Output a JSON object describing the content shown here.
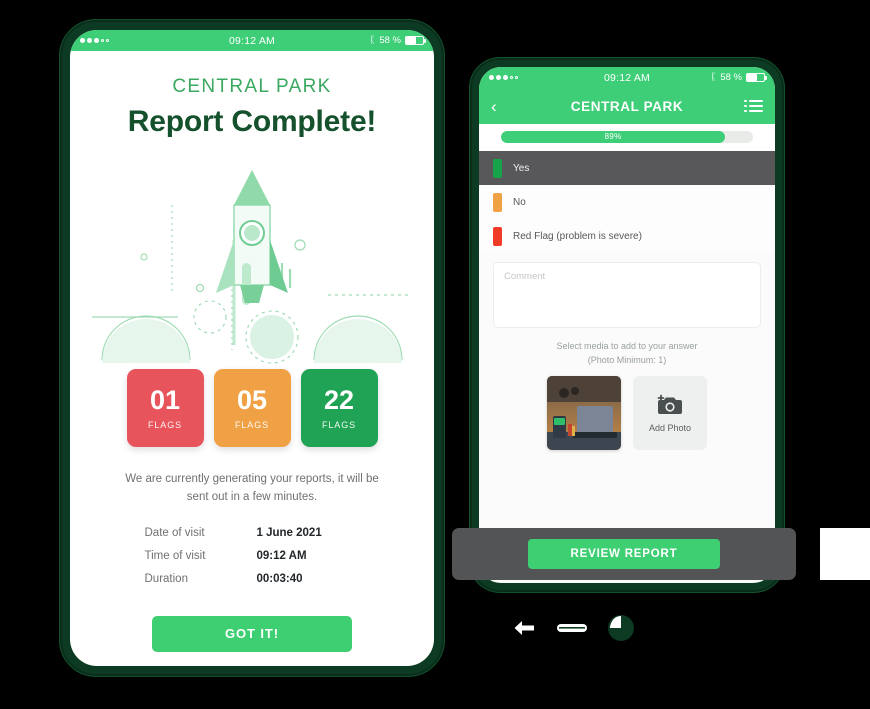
{
  "colors": {
    "brand_green": "#3ecf73",
    "dark_green": "#15512c",
    "frame_green": "#0d3a22",
    "flag_red": "#e8545b",
    "flag_orange": "#f0a145",
    "flag_green": "#21a355",
    "option_selected_bg": "#58585a",
    "footer_bar": "#525456"
  },
  "phone1": {
    "status_bar": {
      "time": "09:12 AM",
      "battery_percent": "58 %",
      "bluetooth_icon": "bluetooth-icon",
      "battery_icon": "battery-icon",
      "signal_icon": "signal-dots-icon"
    },
    "subtitle": "CENTRAL PARK",
    "title": "Report Complete!",
    "illustration": "rocket-illustration",
    "flags": [
      {
        "count": "01",
        "label": "FLAGS",
        "color": "#e8545b",
        "name": "flag-card-red"
      },
      {
        "count": "05",
        "label": "FLAGS",
        "color": "#f0a145",
        "name": "flag-card-orange"
      },
      {
        "count": "22",
        "label": "FLAGS",
        "color": "#21a355",
        "name": "flag-card-green"
      }
    ],
    "note": "We are currently generating your reports, it will be sent out in a few minutes.",
    "details": [
      {
        "key": "Date of visit",
        "value": "1 June 2021"
      },
      {
        "key": "Time of visit",
        "value": "09:12 AM"
      },
      {
        "key": "Duration",
        "value": "00:03:40"
      }
    ],
    "cta": "GOT IT!"
  },
  "phone2": {
    "status_bar": {
      "time": "09:12 AM",
      "battery_percent": "58 %",
      "bluetooth_icon": "bluetooth-icon",
      "battery_icon": "battery-icon",
      "signal_icon": "signal-dots-icon"
    },
    "navbar": {
      "back_icon": "chevron-left-icon",
      "title": "CENTRAL PARK",
      "menu_icon": "list-menu-icon"
    },
    "progress": {
      "label": "89%",
      "percent": 89
    },
    "options": [
      {
        "label": "Yes",
        "color": "#16a34a",
        "selected": true
      },
      {
        "label": "No",
        "color": "#f0a145",
        "selected": false
      },
      {
        "label": "Red Flag (problem is severe)",
        "color": "#ef3b28",
        "selected": false
      }
    ],
    "comment_placeholder": "Comment",
    "media_note_line1": "Select media to add to your answer",
    "media_note_line2": "(Photo Minimum: 1)",
    "photo_thumbnail": "photo-thumbnail",
    "add_photo_label": "Add Photo",
    "add_photo_icon": "camera-plus-icon",
    "review_button": "REVIEW REPORT"
  },
  "android_nav": {
    "back_icon": "android-back-icon",
    "home_icon": "android-home-icon",
    "recents_icon": "android-recents-icon"
  }
}
